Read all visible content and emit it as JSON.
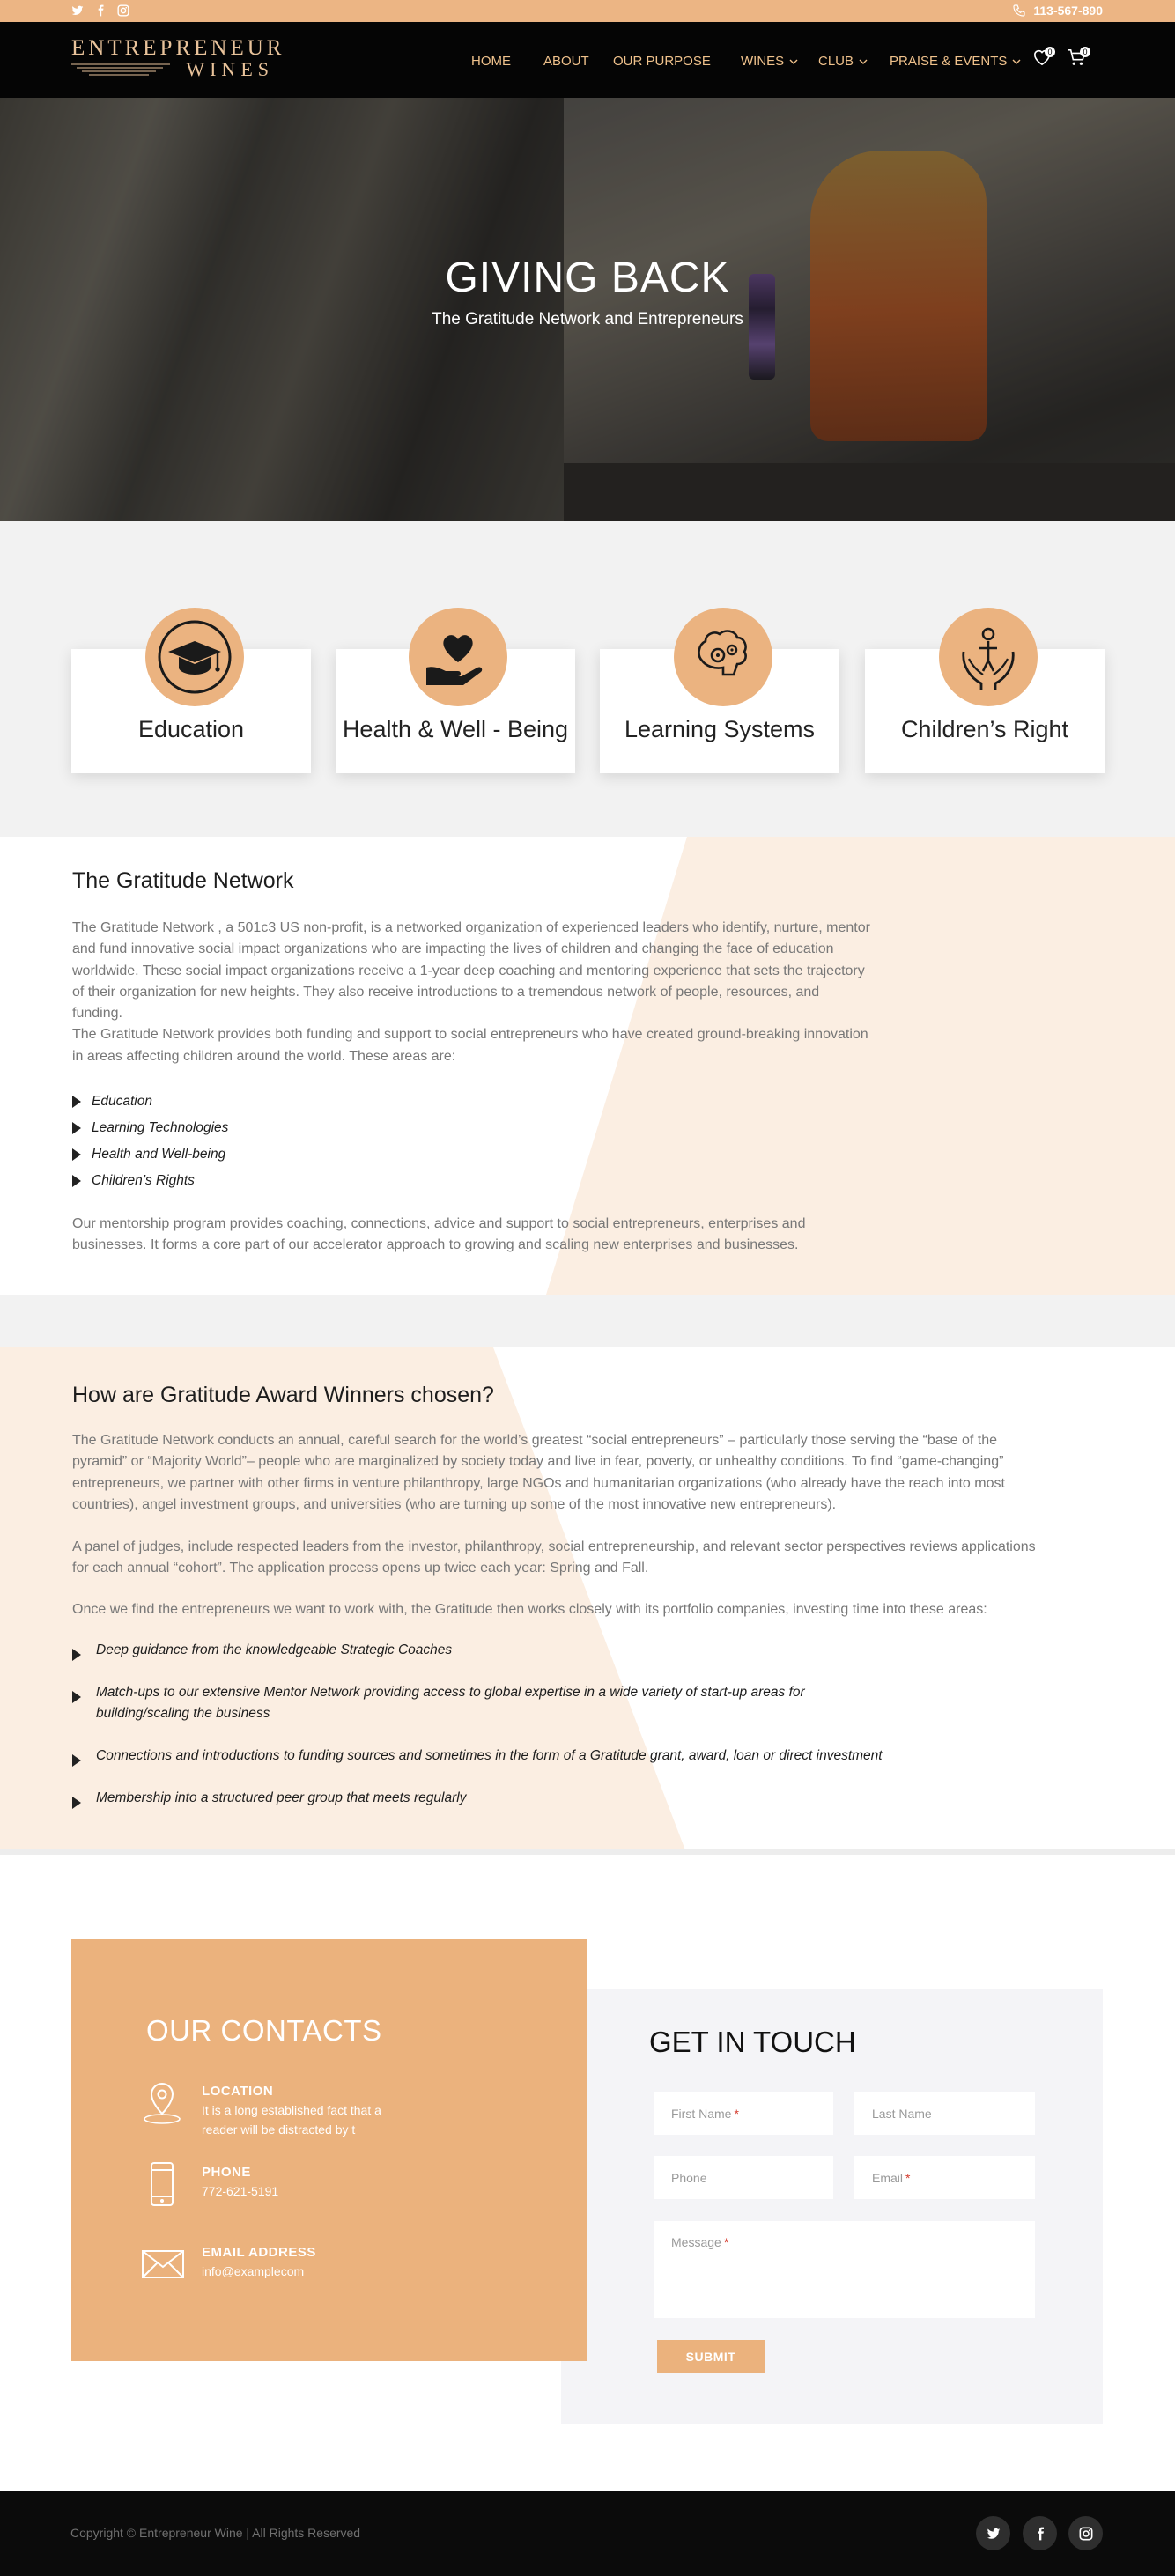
{
  "colors": {
    "accent": "#ecb584",
    "nav_bg": "#050505",
    "menu_text": "#f0c28c",
    "footer_bg": "#0b0b0b",
    "light_band": "#f2f2f2",
    "peach_shape": "#fbeee2"
  },
  "topbar": {
    "social_icons": [
      "twitter-icon",
      "facebook-icon",
      "instagram-icon"
    ],
    "phone": "113-567-890"
  },
  "header": {
    "logo_line1": "ENTREPRENEUR",
    "logo_line2": "WINES",
    "menu": [
      {
        "label": "HOME",
        "dropdown": false
      },
      {
        "label": "ABOUT",
        "dropdown": false
      },
      {
        "label": "OUR PURPOSE",
        "dropdown": false
      },
      {
        "label": "WINES",
        "dropdown": true
      },
      {
        "label": "CLUB",
        "dropdown": true
      },
      {
        "label": "PRAISE & EVENTS",
        "dropdown": true
      }
    ],
    "wishlist_count": "0",
    "cart_count": "0"
  },
  "hero": {
    "title": "GIVING BACK",
    "subtitle": "The Gratitude Network and Entrepreneurs"
  },
  "categories": [
    {
      "label": "Education",
      "icon": "graduation-cap-icon"
    },
    {
      "label": "Health & Well - Being",
      "icon": "heart-in-hand-icon"
    },
    {
      "label": "Learning Systems",
      "icon": "brain-gears-icon"
    },
    {
      "label": "Children’s Right",
      "icon": "child-in-hands-icon"
    }
  ],
  "gratitude": {
    "title": "The Gratitude Network",
    "para1": [
      "The Gratitude Network , a 501c3 US non-profit, is a networked organization of experienced leaders who identify, nurture, mentor",
      "and fund innovative social impact organizations who are impacting the lives of children and changing the face of education",
      "worldwide.  These social impact organizations receive a 1-year deep coaching and mentoring experience that sets the trajectory",
      "of their organization for new heights.  They also receive introductions to a tremendous network of people, resources, and",
      "funding.",
      "The Gratitude Network provides both funding and support to social entrepreneurs who have created ground-breaking innovation",
      "in areas affecting children around the world.  These areas are:"
    ],
    "areas": [
      "Education",
      "Learning Technologies",
      "Health and Well-being",
      "Children’s Rights"
    ],
    "para2": [
      "Our mentorship program provides coaching, connections, advice and support to social entrepreneurs, enterprises and",
      "businesses. It forms a core part of our accelerator approach to growing and scaling new enterprises and businesses."
    ]
  },
  "award": {
    "title": "How are Gratitude Award Winners chosen?",
    "para1": [
      "The Gratitude Network conducts an annual, careful search for the world’s greatest “social entrepreneurs” – particularly those serving the “base of the",
      "pyramid” or “Majority World”– people who are marginalized by society today and live in fear, poverty, or unhealthy conditions. To find “game-changing”",
      "entrepreneurs, we partner with other firms in venture philanthropy, large NGOs and humanitarian organizations (who already have the reach into most",
      "countries), angel investment groups, and universities (who are turning up some of the most innovative new entrepreneurs)."
    ],
    "para2": [
      "A panel of judges, include respected leaders from the investor, philanthropy, social entrepreneurship, and relevant sector perspectives reviews applications",
      "for each annual “cohort”.  The application process opens up twice each year: Spring and Fall."
    ],
    "para3": "Once we find the entrepreneurs we want to work with, the Gratitude then works closely with its portfolio companies, investing time into these areas:",
    "items": [
      [
        "Deep guidance from the knowledgeable Strategic Coaches"
      ],
      [
        "Match-ups to our extensive Mentor Network providing access to global expertise in a wide variety of start-up areas for",
        "building/scaling the  business"
      ],
      [
        "Connections and introductions to funding sources and sometimes in the form of a Gratitude grant, award, loan or direct investment"
      ],
      [
        "Membership into a structured peer group that meets regularly"
      ]
    ]
  },
  "contacts": {
    "title": "OUR CONTACTS",
    "location_label": "LOCATION",
    "location_lines": [
      "It is a long established fact that a",
      "reader will be distracted by t"
    ],
    "phone_label": "PHONE",
    "phone_value": "772-621-5191",
    "email_label": "EMAIL ADDRESS",
    "email_value": "info@examplecom"
  },
  "form": {
    "title": "GET IN TOUCH",
    "first_name": "First Name",
    "last_name": "Last Name",
    "phone": "Phone",
    "email": "Email",
    "message": "Message",
    "required_mark": "*",
    "submit": "SUBMIT"
  },
  "footer": {
    "copyright": "Copyright © Entrepreneur Wine | All Rights Reserved",
    "social_icons": [
      "twitter-icon",
      "facebook-icon",
      "instagram-icon"
    ]
  }
}
